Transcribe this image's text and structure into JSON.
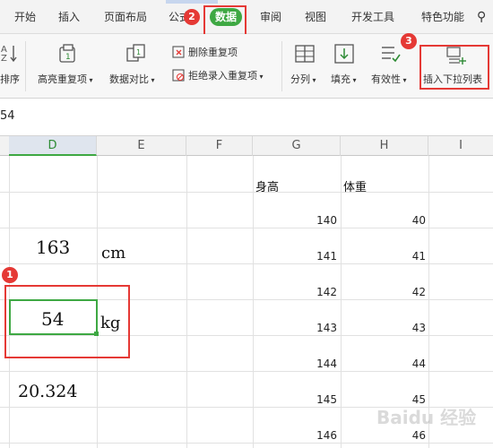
{
  "tabs": [
    "开始",
    "插入",
    "页面布局",
    "公式",
    "数据",
    "审阅",
    "视图",
    "开发工具",
    "特色功能"
  ],
  "ribbon": {
    "sort_label": "排序",
    "highlight_dup": "高亮重复项",
    "compare": "数据对比",
    "remove_dup": "删除重复项",
    "reject_dup": "拒绝录入重复项",
    "split": "分列",
    "fill": "填充",
    "validity": "有效性",
    "insert_dropdown": "插入下拉列表"
  },
  "formula_bar": {
    "value": "54"
  },
  "columns": [
    "D",
    "E",
    "F",
    "G",
    "H",
    "I"
  ],
  "cells": {
    "height_header": "身高",
    "weight_header": "体重",
    "val_163": "163",
    "unit_cm": "cm",
    "val_54": "54",
    "unit_kg": "kg",
    "val_20324": "20.324"
  },
  "heights": [
    "140",
    "141",
    "142",
    "143",
    "144",
    "145",
    "146"
  ],
  "weights": [
    "40",
    "41",
    "42",
    "43",
    "44",
    "45",
    "46"
  ],
  "badges": [
    "1",
    "2",
    "3"
  ],
  "colors": {
    "accent_green": "#3ea843",
    "annotation_red": "#e53935"
  }
}
